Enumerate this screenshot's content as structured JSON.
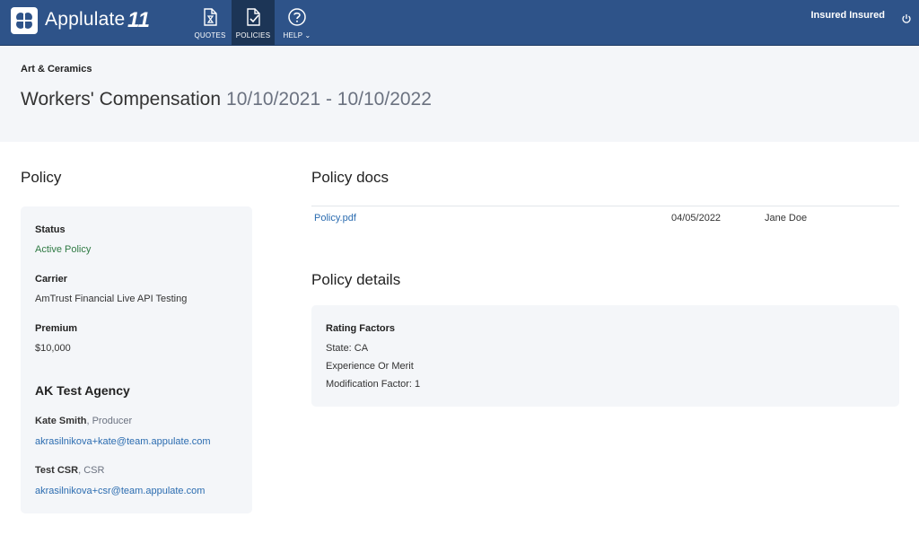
{
  "header": {
    "brand": "Applulate",
    "brand_mark": "11",
    "nav": [
      {
        "label": "QUOTES",
        "icon": "document-hourglass-icon"
      },
      {
        "label": "POLICIES",
        "icon": "document-check-icon",
        "active": true
      },
      {
        "label": "HELP",
        "icon": "help-icon"
      }
    ],
    "user_name": "Insured Insured",
    "colors": {
      "bar": "#2e5389",
      "active_nav": "#1c3556"
    }
  },
  "hero": {
    "subtitle": "Art & Ceramics",
    "title": "Workers' Compensation",
    "dates": "10/10/2021 - 10/10/2022"
  },
  "policy": {
    "heading": "Policy",
    "status_label": "Status",
    "status_value": "Active Policy",
    "carrier_label": "Carrier",
    "carrier_value": "AmTrust Financial Live API Testing",
    "premium_label": "Premium",
    "premium_value": "$10,000",
    "agency": "AK Test Agency",
    "contacts": [
      {
        "name": "Kate Smith",
        "role": ", Producer",
        "email": "akrasilnikova+kate@team.appulate.com"
      },
      {
        "name": "Test CSR",
        "role": ", CSR",
        "email": "akrasilnikova+csr@team.appulate.com"
      }
    ]
  },
  "docs": {
    "heading": "Policy docs",
    "rows": [
      {
        "name": "Policy.pdf",
        "date": "04/05/2022",
        "by": "Jane Doe"
      }
    ]
  },
  "details": {
    "heading": "Policy details",
    "rating_title": "Rating Factors",
    "lines": [
      "State: CA",
      "Experience Or Merit",
      "Modification Factor: 1"
    ]
  }
}
